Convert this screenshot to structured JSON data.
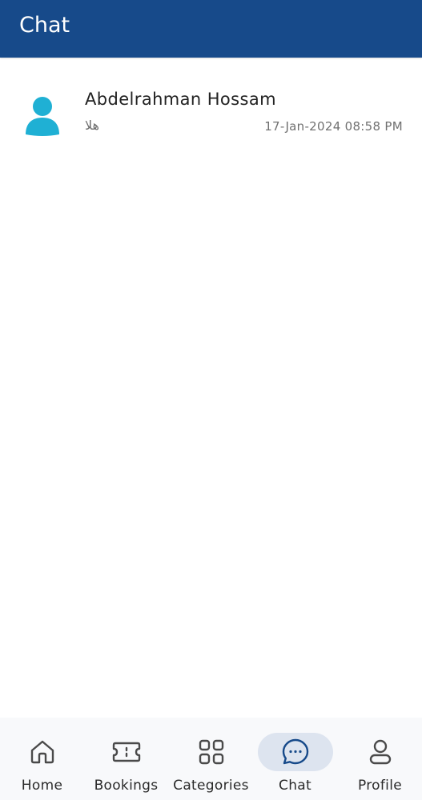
{
  "header": {
    "title": "Chat",
    "background_color": "#174a8a"
  },
  "chats": [
    {
      "name": "Abdelrahman Hossam",
      "last_message": "هلا",
      "timestamp": "17-Jan-2024 08:58 PM",
      "avatar_icon": "person-icon",
      "avatar_color": "#1fb0d4"
    }
  ],
  "bottom_nav": {
    "active": "Chat",
    "active_color": "#174a8a",
    "items": [
      {
        "label": "Home",
        "icon": "home-icon"
      },
      {
        "label": "Bookings",
        "icon": "ticket-icon"
      },
      {
        "label": "Categories",
        "icon": "grid-icon"
      },
      {
        "label": "Chat",
        "icon": "chat-bubble-icon"
      },
      {
        "label": "Profile",
        "icon": "profile-icon"
      }
    ]
  }
}
